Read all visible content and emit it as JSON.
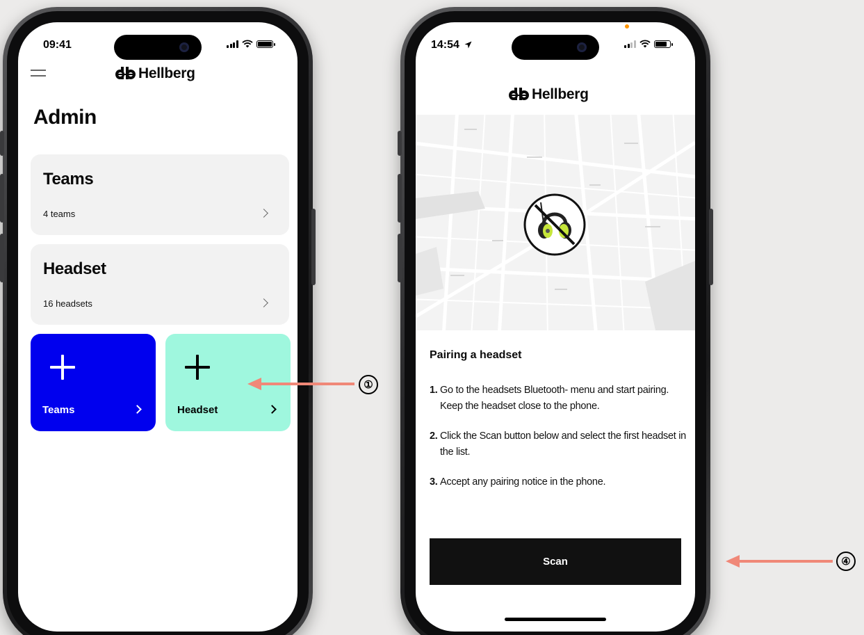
{
  "colors": {
    "background": "#ecebea",
    "teams_tile": "#0000ee",
    "headset_tile": "#9ff7de",
    "card_bg": "#f2f2f2",
    "scan_button": "#111111",
    "annotation_arrow": "#f08878"
  },
  "phone1": {
    "status_time": "09:41",
    "logo_text": "Hellberg",
    "page_title": "Admin",
    "cards": [
      {
        "title": "Teams",
        "subtitle": "4 teams"
      },
      {
        "title": "Headset",
        "subtitle": "16 headsets"
      }
    ],
    "tiles": [
      {
        "label": "Teams",
        "icon": "plus-icon"
      },
      {
        "label": "Headset",
        "icon": "plus-icon"
      }
    ]
  },
  "phone2": {
    "status_time": "14:54",
    "logo_text": "Hellberg",
    "map_icon": "no-headset-icon",
    "pairing_title": "Pairing a headset",
    "steps": [
      {
        "num": "1.",
        "text": "Go to the headsets Bluetooth- menu and start pairing. Keep the headset close to the phone."
      },
      {
        "num": "2.",
        "text": "Click the Scan button below and select the first headset in the list."
      },
      {
        "num": "3.",
        "text": "Accept any pairing notice in the phone."
      }
    ],
    "scan_button": "Scan"
  },
  "annotations": [
    {
      "label": "①"
    },
    {
      "label": "④"
    }
  ]
}
